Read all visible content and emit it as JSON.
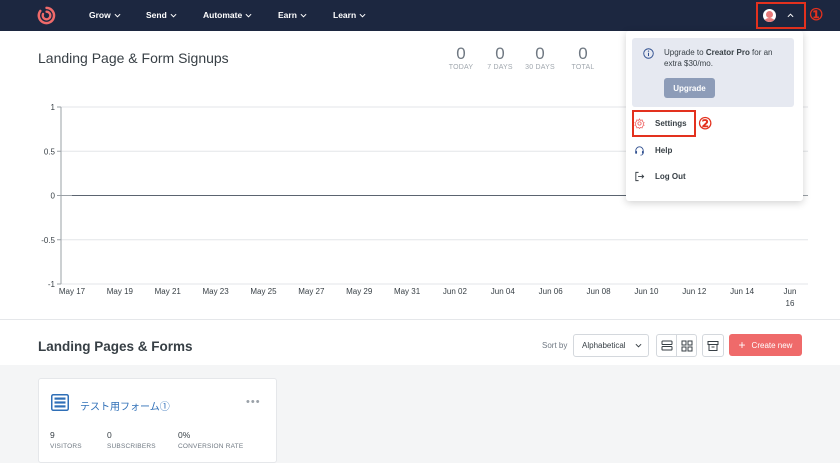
{
  "nav": {
    "items": [
      {
        "label": "Grow"
      },
      {
        "label": "Send"
      },
      {
        "label": "Automate"
      },
      {
        "label": "Earn"
      },
      {
        "label": "Learn"
      }
    ],
    "step1_marker": "①"
  },
  "header": {
    "title": "Landing Page & Form Signups",
    "stats": [
      {
        "value": "0",
        "label": "TODAY"
      },
      {
        "value": "0",
        "label": "7 DAYS"
      },
      {
        "value": "0",
        "label": "30 DAYS"
      },
      {
        "value": "0",
        "label": "TOTAL"
      }
    ]
  },
  "chart_data": {
    "type": "line",
    "x": [
      "May 17",
      "May 19",
      "May 21",
      "May 23",
      "May 25",
      "May 27",
      "May 29",
      "May 31",
      "Jun 02",
      "Jun 04",
      "Jun 06",
      "Jun 08",
      "Jun 10",
      "Jun 12",
      "Jun 14",
      "Jun 16"
    ],
    "series": [
      {
        "values": [
          0,
          0,
          0,
          0,
          0,
          0,
          0,
          0,
          0,
          0,
          0,
          0,
          0,
          0,
          0,
          0
        ]
      }
    ],
    "yticks": [
      "1",
      "0.5",
      "0",
      "-0.5",
      "-1"
    ],
    "ylim": [
      -1,
      1
    ],
    "grid": true,
    "title": "",
    "xlabel": "",
    "ylabel": ""
  },
  "chart_labels": {
    "last_x_line1": "Jun",
    "last_x_line2": "16"
  },
  "section": {
    "title": "Landing Pages & Forms",
    "sort_label": "Sort by",
    "sort_value": "Alphabetical",
    "create_label": "Create new",
    "create_icon": "+"
  },
  "form_card": {
    "name": "テスト用フォーム①",
    "menu": "•••",
    "stats": [
      {
        "value": "9",
        "label": "VISITORS"
      },
      {
        "value": "0",
        "label": "SUBSCRIBERS"
      },
      {
        "value": "0%",
        "label": "CONVERSION RATE"
      }
    ]
  },
  "dropdown": {
    "upgrade_prefix": "Upgrade to ",
    "upgrade_plan": "Creator Pro",
    "upgrade_suffix": " for an extra $30/mo.",
    "upgrade_button": "Upgrade",
    "items": [
      {
        "label": "Settings",
        "icon": "gear-icon"
      },
      {
        "label": "Help",
        "icon": "headset-icon"
      },
      {
        "label": "Log Out",
        "icon": "logout-icon"
      }
    ],
    "step2_marker": "②"
  },
  "colors": {
    "nav_bg": "#1c2740",
    "accent": "#ef6a6a",
    "highlight": "#e3311e",
    "link": "#2f6fb7"
  }
}
